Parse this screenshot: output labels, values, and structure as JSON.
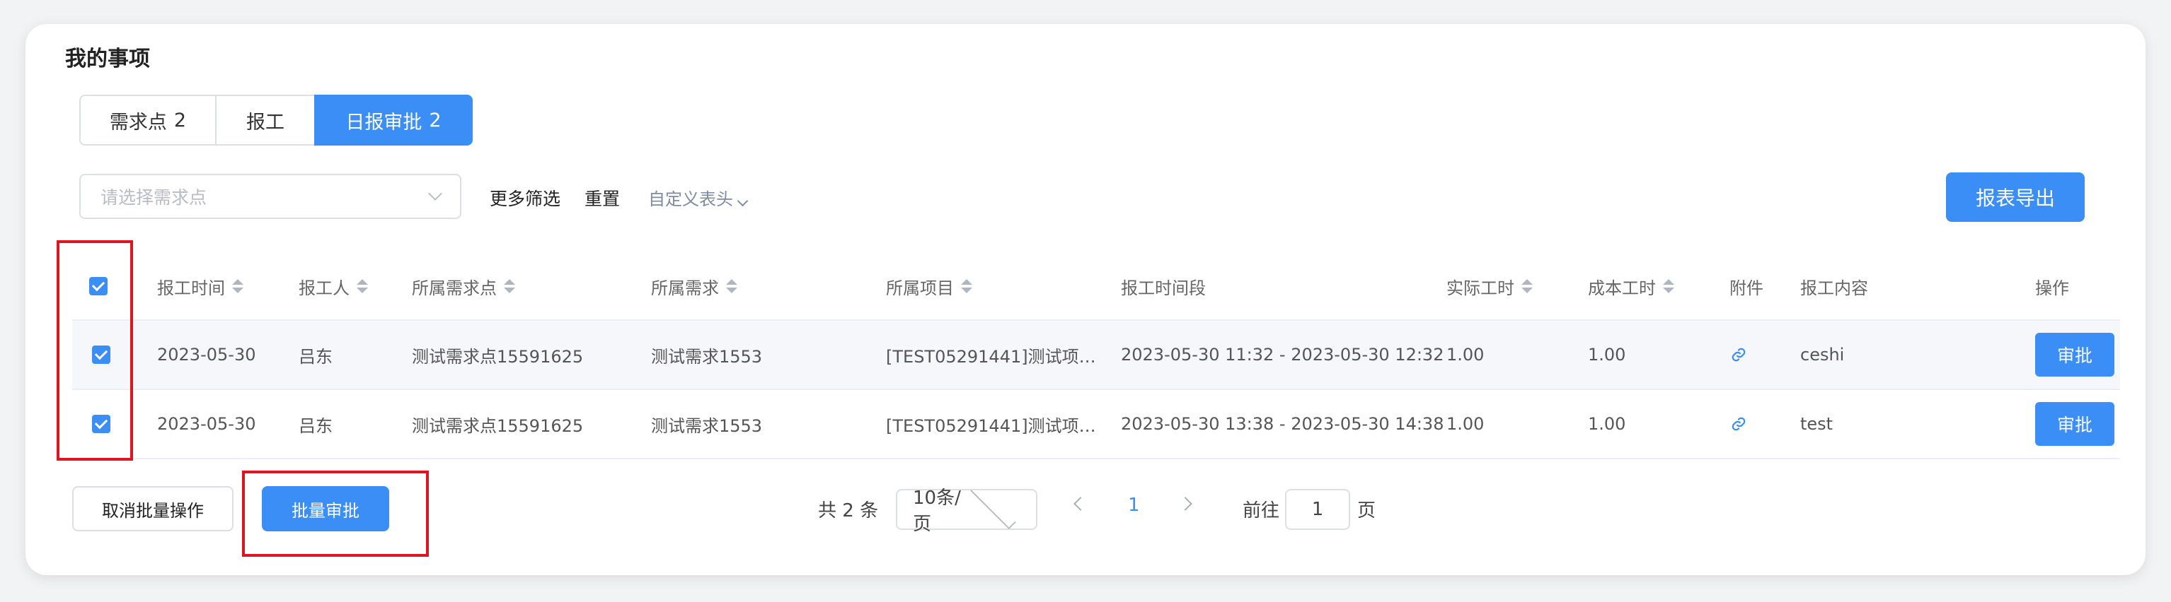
{
  "page_title": "我的事项",
  "tabs": [
    {
      "label": "需求点",
      "count": "2"
    },
    {
      "label": "报工",
      "count": ""
    },
    {
      "label": "日报审批",
      "count": "2"
    }
  ],
  "filters": {
    "select_placeholder": "请选择需求点",
    "more_filters": "更多筛选",
    "reset": "重置",
    "custom_header": "自定义表头",
    "export": "报表导出"
  },
  "table": {
    "columns": [
      "报工时间",
      "报工人",
      "所属需求点",
      "所属需求",
      "所属项目",
      "报工时间段",
      "实际工时",
      "成本工时",
      "附件",
      "报工内容",
      "操作"
    ],
    "rows": [
      {
        "date": "2023-05-30",
        "person": "吕东",
        "req_point": "测试需求点15591625",
        "req": "测试需求1553",
        "project": "[TEST05291441]测试项…",
        "period": "2023-05-30 11:32 - 2023-05-30 12:32",
        "actual": "1.00",
        "cost": "1.00",
        "content": "ceshi",
        "action": "审批"
      },
      {
        "date": "2023-05-30",
        "person": "吕东",
        "req_point": "测试需求点15591625",
        "req": "测试需求1553",
        "project": "[TEST05291441]测试项…",
        "period": "2023-05-30 13:38 - 2023-05-30 14:38",
        "actual": "1.00",
        "cost": "1.00",
        "content": "test",
        "action": "审批"
      }
    ]
  },
  "footer": {
    "cancel_batch": "取消批量操作",
    "batch_approve": "批量审批",
    "total": "共 2 条",
    "page_size": "10条/页",
    "current_page": "1",
    "goto_label": "前往",
    "goto_value": "1",
    "page_suffix": "页"
  },
  "colors": {
    "primary": "#3a8ef6",
    "highlight": "#e0141e"
  }
}
